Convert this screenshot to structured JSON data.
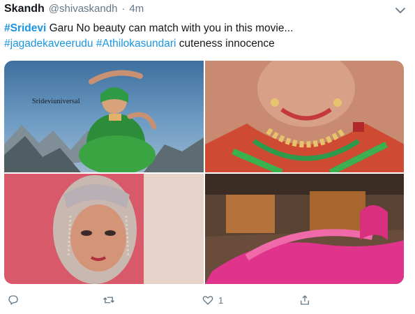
{
  "tweet": {
    "author_name": "Skandh",
    "author_handle": "@shivaskandh",
    "separator": "·",
    "timestamp": "4m",
    "text": {
      "hashtag1": "#Sridevi",
      "line1_rest": " Garu No beauty can match with you in this movie...",
      "hashtag2": "#jagadekaveerudu",
      "space": " ",
      "hashtag3": "#Athilokasundari",
      "line2_rest": " cuteness innocence"
    },
    "media": {
      "count": 4,
      "watermark": "Srideviuniversal"
    },
    "actions": {
      "reply_icon": "reply-icon",
      "retweet_icon": "retweet-icon",
      "like_icon": "heart-icon",
      "like_count": "1",
      "share_icon": "share-icon"
    }
  },
  "colors": {
    "link": "#1b95e0",
    "muted": "#657786",
    "text": "#14171a"
  }
}
